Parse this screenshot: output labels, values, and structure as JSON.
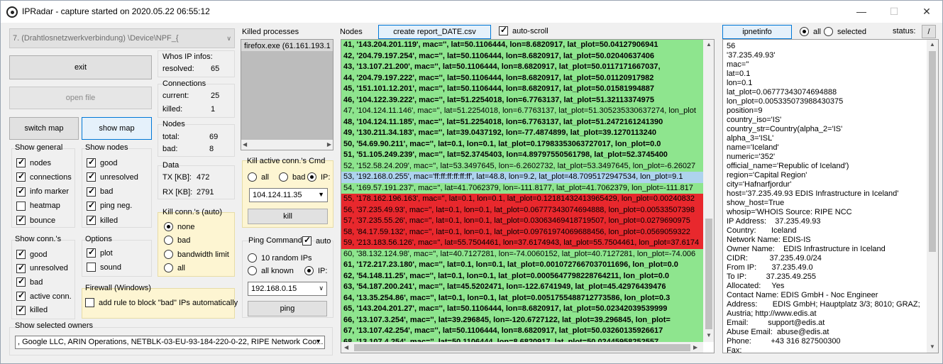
{
  "window": {
    "title": "IPRadar - capture started on 2020.05.22 06:55:12"
  },
  "controls": {
    "interface_select": "7. (Drahtlosnetzwerkverbindung)  \\Device\\NPF_{",
    "exit": "exit",
    "open_file": "open file",
    "switch_map": "switch map",
    "show_map": "show map"
  },
  "whois": {
    "title": "Whos IP infos:",
    "resolved_label": "resolved:",
    "resolved_value": "65"
  },
  "connections": {
    "title": "Connections",
    "current_label": "current:",
    "current_value": "25",
    "killed_label": "killed:",
    "killed_value": "1"
  },
  "nodes_stats": {
    "title": "Nodes",
    "total_label": "total:",
    "total_value": "69",
    "bad_label": "bad:",
    "bad_value": "8"
  },
  "data_stats": {
    "title": "Data",
    "tx_label": "TX [KB]:",
    "tx_value": "472",
    "rx_label": "RX [KB]:",
    "rx_value": "2791"
  },
  "show_general": {
    "title": "Show general",
    "items": [
      {
        "label": "nodes",
        "checked": true
      },
      {
        "label": "connections",
        "checked": true
      },
      {
        "label": "info marker",
        "checked": true
      },
      {
        "label": "heatmap",
        "checked": false
      },
      {
        "label": "bounce",
        "checked": true
      }
    ]
  },
  "show_nodes": {
    "title": "Show nodes",
    "items": [
      {
        "label": "good",
        "checked": true
      },
      {
        "label": "unresolved",
        "checked": true
      },
      {
        "label": "bad",
        "checked": true
      },
      {
        "label": "ping neg.",
        "checked": true
      },
      {
        "label": "killed",
        "checked": true
      }
    ]
  },
  "show_conns": {
    "title": "Show conn.'s",
    "items": [
      {
        "label": "good",
        "checked": true
      },
      {
        "label": "unresolved",
        "checked": true
      },
      {
        "label": "bad",
        "checked": true
      },
      {
        "label": "active conn.",
        "checked": true
      },
      {
        "label": "killed",
        "checked": true
      }
    ]
  },
  "options": {
    "title": "Options",
    "items": [
      {
        "label": "plot",
        "checked": true
      },
      {
        "label": "sound",
        "checked": false
      }
    ]
  },
  "kill_auto": {
    "title": "Kill conn.'s (auto)",
    "options": [
      "none",
      "bad",
      "bandwidth limit",
      "all"
    ],
    "selected": "none"
  },
  "firewall": {
    "title": "Firewall (Windows)",
    "checkbox_label": "add rule to block \"bad\" IPs automatically",
    "checked": false
  },
  "owners": {
    "title": "Show selected owners",
    "value": ", Google LLC, ARIN Operations, NETBLK-03-EU-93-184-220-0-22, RIPE Network Coo..."
  },
  "killed_processes": {
    "title": "Killed processes",
    "items": [
      "firefox.exe (61.161.193.1"
    ]
  },
  "kill_cmd": {
    "title": "Kill active conn.'s Cmd",
    "options": [
      "all",
      "bad",
      "IP:"
    ],
    "selected": "IP:",
    "ip_value": "104.124.11.35",
    "button": "kill"
  },
  "ping": {
    "title": "Ping Command",
    "auto_label": "auto",
    "auto_checked": true,
    "options": [
      "10 random IPs",
      "all known",
      "IP:"
    ],
    "selected": "IP:",
    "ip_value": "192.168.0.15",
    "button": "ping"
  },
  "nodes_panel": {
    "title": "Nodes",
    "report_button": "create report_DATE.csv",
    "autoscroll_label": "auto-scroll",
    "autoscroll_checked": true
  },
  "node_rows": [
    {
      "text": "41, '143.204.201.119', mac='', lat=50.1106444, lon=8.6820917, lat_plot=50.04127906941",
      "color": "g",
      "bold": true
    },
    {
      "text": "42, '204.79.197.254', mac='', lat=50.1106444, lon=8.6820917, lat_plot=50.02040637406",
      "color": "g",
      "bold": true
    },
    {
      "text": "43, '13.107.21.200', mac='', lat=50.1106444, lon=8.6820917, lat_plot=50.0117171667037,",
      "color": "g",
      "bold": true
    },
    {
      "text": "44, '204.79.197.222', mac='', lat=50.1106444, lon=8.6820917, lat_plot=50.01120917982",
      "color": "g",
      "bold": true
    },
    {
      "text": "45, '151.101.12.201', mac='', lat=50.1106444, lon=8.6820917, lat_plot=50.01581994887",
      "color": "g",
      "bold": true
    },
    {
      "text": "46, '104.122.39.222', mac='', lat=51.2254018, lon=6.7763137, lat_plot=51.32113374975",
      "color": "g",
      "bold": true
    },
    {
      "text": "47, '104.124.11.146', mac='', lat=51.2254018, lon=6.7763137, lat_plot=51.305235330637274, lon_plot",
      "color": "g",
      "bold": false
    },
    {
      "text": "48, '104.124.11.185', mac='', lat=51.2254018, lon=6.7763137, lat_plot=51.2472161241390",
      "color": "g",
      "bold": true
    },
    {
      "text": "49, '130.211.34.183', mac='', lat=39.0437192, lon=-77.4874899, lat_plot=39.1270113240",
      "color": "g",
      "bold": true
    },
    {
      "text": "50, '54.69.90.211', mac='', lat=0.1, lon=0.1, lat_plot=0.17983353063727017, lon_plot=0.0",
      "color": "g",
      "bold": true
    },
    {
      "text": "51, '51.105.249.239', mac='', lat=52.3745403, lon=4.89797550561798, lat_plot=52.3745400",
      "color": "g",
      "bold": true
    },
    {
      "text": "52, '152.58.24.209', mac='', lat=53.3497645, lon=-6.2602732, lat_plot=53.3497645, lon_plot=-6.26027",
      "color": "g",
      "bold": false
    },
    {
      "text": "53, '192.168.0.255', mac='ff:ff:ff:ff:ff:ff', lat=48.8, lon=9.2, lat_plot=48.7095172947534, lon_plot=9.1",
      "color": "b",
      "bold": false
    },
    {
      "text": "54, '169.57.191.237', mac='', lat=41.7062379, lon=-111.8177, lat_plot=41.7062379, lon_plot=-111.817",
      "color": "g",
      "bold": false
    },
    {
      "text": "55, '178.162.196.163', mac='', lat=0.1, lon=0.1, lat_plot=0.12181432413965429, lon_plot=0.00240832",
      "color": "r",
      "bold": false
    },
    {
      "text": "56, '37.235.49.93', mac='', lat=0.1, lon=0.1, lat_plot=0.06777343074694888, lon_plot=0.00533507398",
      "color": "r",
      "bold": false
    },
    {
      "text": "57, '37.235.55.26', mac='', lat=0.1, lon=0.1, lat_plot=0.03063469418719507, lon_plot=0.0279690975",
      "color": "r",
      "bold": false
    },
    {
      "text": "58, '84.17.59.132', mac='', lat=0.1, lon=0.1, lat_plot=0.09761974069688456, lon_plot=0.0569059322",
      "color": "r",
      "bold": false
    },
    {
      "text": "59, '213.183.56.126', mac='', lat=55.7504461, lon=37.6174943, lat_plot=55.7504461, lon_plot=37.6174",
      "color": "r",
      "bold": false
    },
    {
      "text": "60, '38.132.124.98', mac='', lat=40.7127281, lon=-74.0060152, lat_plot=40.7127281, lon_plot=-74.006",
      "color": "g",
      "bold": false
    },
    {
      "text": "61, '172.217.23.180', mac='', lat=0.1, lon=0.1, lat_plot=0.0010727667037011696, lon_plot=0.0",
      "color": "g",
      "bold": true
    },
    {
      "text": "62, '54.148.11.25', mac='', lat=0.1, lon=0.1, lat_plot=0.0005647798228764211, lon_plot=0.0",
      "color": "g",
      "bold": true
    },
    {
      "text": "63, '54.187.200.241', mac='', lat=45.5202471, lon=-122.6741949, lat_plot=45.42976439476",
      "color": "g",
      "bold": true
    },
    {
      "text": "64, '13.35.254.86', mac='', lat=0.1, lon=0.1, lat_plot=0.0051755488712773586, lon_plot=0.3",
      "color": "g",
      "bold": true
    },
    {
      "text": "65, '143.204.201.27', mac='', lat=50.1106444, lon=8.6820917, lat_plot=50.02342039539999",
      "color": "g",
      "bold": true
    },
    {
      "text": "66, '13.107.3.254', mac='', lat=39.296845, lon=-120.6727122, lat_plot=39.296845, lon_plot=",
      "color": "g",
      "bold": true
    },
    {
      "text": "67, '13.107.42.254', mac='', lat=50.1106444, lon=8.6820917, lat_plot=50.03260135926617",
      "color": "g",
      "bold": true
    },
    {
      "text": "68, '13.107.4.254', mac='', lat=50.1106444, lon=8.6820917, lat_plot=50.02445958252557",
      "color": "g",
      "bold": true
    }
  ],
  "info_panel": {
    "button": "ipnetinfo",
    "radio_all": "all",
    "radio_selected": "selected",
    "selected": "all",
    "status_label": "status:",
    "status_value": "/",
    "lines": [
      "56",
      "'37.235.49.93'",
      "mac=''",
      "lat=0.1",
      "lon=0.1",
      "lat_plot=0.06777343074694888",
      "lon_plot=0.005335073988430375",
      "position=9",
      "country_iso='IS'",
      "country_str=Country(alpha_2='IS'",
      "alpha_3='ISL'",
      "name='Iceland'",
      "numeric='352'",
      "official_name='Republic of Iceland')",
      "region='Capital Region'",
      "city='Hafnarfjordur'",
      "host='37.235.49.93 EDIS Infrastructure in Iceland'",
      "show_host=True",
      "whosip='WHOIS Source: RIPE NCC",
      "IP Address:    37.235.49.93",
      "Country:       Iceland",
      "Network Name: EDIS-IS",
      "Owner Name:    EDIS Infrastructure in Iceland",
      "CIDR:          37.235.49.0/24",
      "From IP:       37.235.49.0",
      "To IP:         37.235.49.255",
      "Allocated:     Yes",
      "Contact Name: EDIS GmbH - Noc Engineer",
      "Address:       EDIS GmbH; Hauptplatz 3/3; 8010; GRAZ;",
      "Austria; http://www.edis.at",
      "Email:         support@edis.at",
      "Abuse Email:  abuse@edis.at",
      "Phone:         +43 316 827500300",
      "Fax:"
    ]
  }
}
